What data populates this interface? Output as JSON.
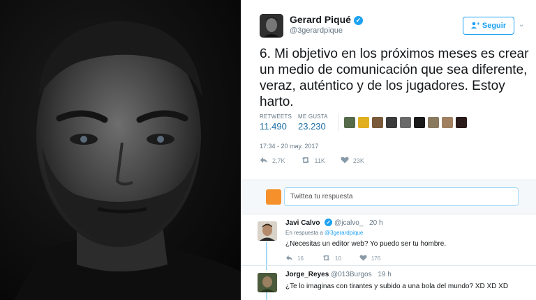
{
  "colors": {
    "accent": "#1da1f2",
    "count_blue": "#1d6fa5",
    "muted": "#657786",
    "photo_bg": "#0a0a0a"
  },
  "tweet": {
    "author": {
      "name": "Gerard Piqué",
      "handle": "@3gerardpique",
      "verified_icon": "verified-badge-icon"
    },
    "follow_label": "Seguir",
    "text": "6. Mi objetivo en los próximos meses es crear un medio de comunicación que sea diferente, veraz, auténtico y de los jugadores. Estoy harto.",
    "stats": {
      "retweets_label": "RETWEETS",
      "retweets_value": "11.490",
      "likes_label": "ME GUSTA",
      "likes_value": "23.230"
    },
    "timestamp": "17:34 - 20 may. 2017",
    "actions": {
      "replies": "2,7K",
      "retweets": "11K",
      "likes": "23K"
    }
  },
  "reply_box": {
    "placeholder": "Twittea tu respuesta"
  },
  "replies": [
    {
      "name": "Javi Calvo",
      "handle": "@jcalvo_",
      "time": "20 h",
      "in_reply_prefix": "En respuesta a",
      "in_reply_mention": "@3gerardpique",
      "text": "¿Necesitas un editor web? Yo puedo ser tu hombre.",
      "actions": {
        "replies": "16",
        "retweets": "10",
        "likes": "176"
      }
    },
    {
      "name": "Jorge_Reyes",
      "handle": "@013Burgos",
      "time": "19 h",
      "text": "¿Te lo imaginas con tirantes y subido a una bola del mundo? XD XD XD"
    }
  ]
}
